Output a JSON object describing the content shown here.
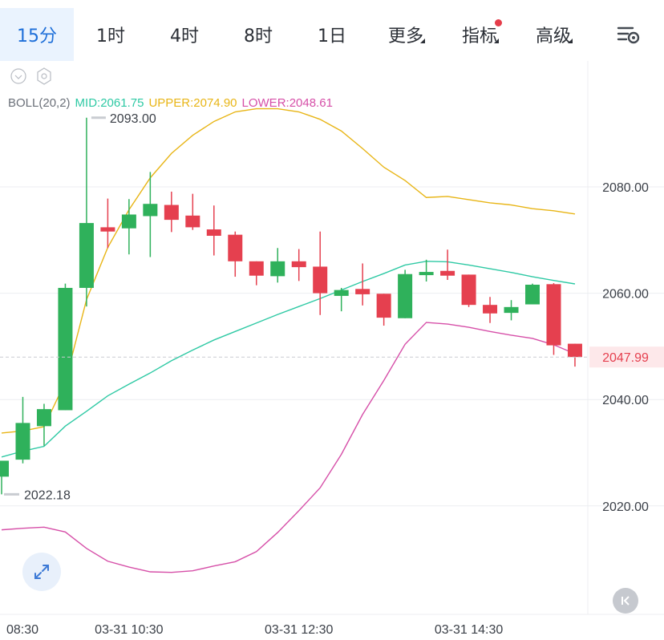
{
  "timeframe_tabs": [
    {
      "label": "15分",
      "active": true
    },
    {
      "label": "1时"
    },
    {
      "label": "4时"
    },
    {
      "label": "8时"
    },
    {
      "label": "1日"
    },
    {
      "label": "更多",
      "dropdown": true
    },
    {
      "label": "指标",
      "dropdown": true,
      "badge": true
    },
    {
      "label": "高级",
      "dropdown": true
    }
  ],
  "icons": {
    "settings": "settings-icon",
    "zoom": "expand-icon",
    "back": "collapse-left-icon",
    "eye": "eye-toggle-icon",
    "gear": "indicator-settings-icon"
  },
  "colors": {
    "up": "#2fb15b",
    "down": "#e5404f",
    "mid": "#2ec9a4",
    "upper": "#e8b516",
    "lower": "#d64fa8",
    "accent": "#1e6fd9"
  },
  "chart_data": {
    "type": "candlestick",
    "indicator": {
      "name": "BOLL(20,2)",
      "mid_label": "MID:2061.75",
      "upper_label": "UPPER:2074.90",
      "lower_label": "LOWER:2048.61"
    },
    "y_axis": {
      "ticks": [
        2080,
        2060,
        2040,
        2020
      ],
      "tick_labels": [
        "2080.00",
        "2060.00",
        "2040.00",
        "2020.00"
      ],
      "range": [
        2006,
        2105
      ]
    },
    "x_axis": {
      "labels": [
        "08:30",
        "03-31 10:30",
        "03-31 12:30",
        "03-31 14:30"
      ],
      "label_candle_index": [
        0,
        6,
        14,
        22
      ]
    },
    "current_price": 2047.99,
    "current_price_label": "2047.99",
    "high_marker": {
      "value": 2093.0,
      "label": "2093.00",
      "candle_index": 4
    },
    "low_marker": {
      "value": 2022.18,
      "label": "2022.18",
      "candle_index": 0
    },
    "candles": [
      {
        "o": 2025.5,
        "h": 2028,
        "l": 2022.18,
        "c": 2028.5
      },
      {
        "o": 2028.7,
        "h": 2040.5,
        "l": 2028.0,
        "c": 2035.6
      },
      {
        "o": 2035.0,
        "h": 2039.2,
        "l": 2031.3,
        "c": 2038.2
      },
      {
        "o": 2038.0,
        "h": 2061.8,
        "l": 2038.0,
        "c": 2061.0
      },
      {
        "o": 2061.0,
        "h": 2093.0,
        "l": 2057.5,
        "c": 2073.2
      },
      {
        "o": 2072.4,
        "h": 2077.8,
        "l": 2068.5,
        "c": 2071.6
      },
      {
        "o": 2072.2,
        "h": 2077.7,
        "l": 2067.3,
        "c": 2074.8
      },
      {
        "o": 2074.5,
        "h": 2082.8,
        "l": 2066.8,
        "c": 2076.8
      },
      {
        "o": 2076.6,
        "h": 2079.1,
        "l": 2071.5,
        "c": 2073.8
      },
      {
        "o": 2074.6,
        "h": 2078.7,
        "l": 2071.9,
        "c": 2072.4
      },
      {
        "o": 2072.0,
        "h": 2076.5,
        "l": 2067.1,
        "c": 2070.8
      },
      {
        "o": 2071.0,
        "h": 2071.6,
        "l": 2063.1,
        "c": 2066.0
      },
      {
        "o": 2066.0,
        "h": 2066.0,
        "l": 2061.5,
        "c": 2063.3
      },
      {
        "o": 2063.2,
        "h": 2068.5,
        "l": 2062.0,
        "c": 2066.0
      },
      {
        "o": 2066.0,
        "h": 2068.3,
        "l": 2062.3,
        "c": 2064.9
      },
      {
        "o": 2065.0,
        "h": 2071.6,
        "l": 2055.9,
        "c": 2060.0
      },
      {
        "o": 2059.5,
        "h": 2061.0,
        "l": 2056.6,
        "c": 2060.6
      },
      {
        "o": 2060.8,
        "h": 2065.6,
        "l": 2057.7,
        "c": 2059.8
      },
      {
        "o": 2059.9,
        "h": 2059.9,
        "l": 2053.9,
        "c": 2055.4
      },
      {
        "o": 2055.3,
        "h": 2064.4,
        "l": 2055.3,
        "c": 2063.6
      },
      {
        "o": 2063.4,
        "h": 2066.3,
        "l": 2062.2,
        "c": 2064.0
      },
      {
        "o": 2064.2,
        "h": 2068.2,
        "l": 2062.5,
        "c": 2063.3
      },
      {
        "o": 2063.5,
        "h": 2063.5,
        "l": 2057.4,
        "c": 2057.8
      },
      {
        "o": 2057.8,
        "h": 2059.3,
        "l": 2054.4,
        "c": 2056.2
      },
      {
        "o": 2056.3,
        "h": 2058.7,
        "l": 2054.9,
        "c": 2057.4
      },
      {
        "o": 2057.9,
        "h": 2061.8,
        "l": 2057.9,
        "c": 2061.6
      },
      {
        "o": 2061.7,
        "h": 2061.9,
        "l": 2048.4,
        "c": 2050.2
      },
      {
        "o": 2050.5,
        "h": 2050.5,
        "l": 2046.2,
        "c": 2047.99
      }
    ],
    "boll_mid": [
      2029.2,
      2030.3,
      2031.2,
      2035.0,
      2037.8,
      2040.7,
      2042.9,
      2045.0,
      2047.3,
      2049.3,
      2051.2,
      2052.8,
      2054.4,
      2056.0,
      2057.5,
      2059.0,
      2060.6,
      2062.2,
      2063.7,
      2065.3,
      2066.0,
      2065.9,
      2065.3,
      2064.6,
      2063.9,
      2063.1,
      2062.4,
      2061.75
    ],
    "boll_upper": [
      2033.7,
      2034.1,
      2034.9,
      2043.3,
      2058.8,
      2068.6,
      2075.7,
      2081.7,
      2086.3,
      2089.7,
      2092.3,
      2094.1,
      2094.7,
      2094.7,
      2094.1,
      2092.7,
      2090.5,
      2087.2,
      2083.7,
      2081.2,
      2078.0,
      2078.2,
      2077.6,
      2077.0,
      2076.6,
      2075.9,
      2075.5,
      2074.9
    ],
    "boll_lower": [
      2015.5,
      2015.8,
      2016.0,
      2015.1,
      2012.0,
      2009.6,
      2008.5,
      2007.6,
      2007.5,
      2007.8,
      2008.7,
      2009.5,
      2011.4,
      2015.0,
      2019.1,
      2023.4,
      2029.7,
      2037.2,
      2043.6,
      2050.4,
      2054.5,
      2054.2,
      2053.6,
      2052.8,
      2052.1,
      2051.5,
      2050.3,
      2048.61
    ]
  }
}
